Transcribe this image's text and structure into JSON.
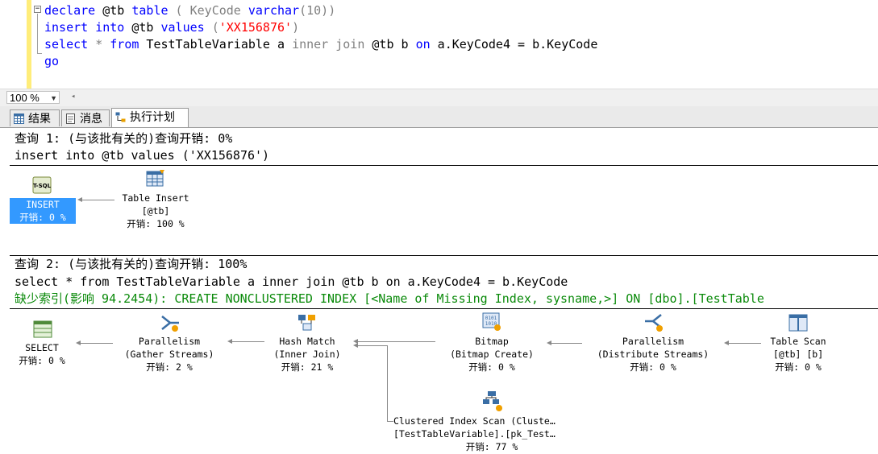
{
  "editor": {
    "line1": {
      "kw1": "declare",
      "var": " @tb ",
      "kw2": "table",
      "p1": " ( KeyCode ",
      "kw3": "varchar",
      "p2": "(10)",
      "p3": ")"
    },
    "line2": {
      "kw1": "insert",
      "sp1": " ",
      "kw2": "into",
      "var": " @tb ",
      "kw3": "values",
      "p1": " (",
      "str": "'XX156876'",
      "p2": ")"
    },
    "line3": {
      "kw1": "select",
      "op": " * ",
      "kw2": "from",
      "t1": " TestTableVariable a ",
      "kw3": "inner join",
      "t2": " @tb b ",
      "kw4": "on",
      "t3": " a.KeyCode4 = b.KeyCode"
    },
    "line4": {
      "kw1": "go"
    }
  },
  "zoom": {
    "value": "100 %"
  },
  "tabs": [
    {
      "label": "结果",
      "icon": "grid-icon"
    },
    {
      "label": "消息",
      "icon": "message-icon"
    },
    {
      "label": "执行计划",
      "icon": "execution-plan-icon"
    }
  ],
  "query1": {
    "header": "查询 1: (与该批有关的)查询开销: 0%",
    "sql": "insert into @tb values ('XX156876')",
    "nodes": {
      "insert": {
        "l1": "INSERT",
        "cost": "开销: 0 %"
      },
      "table_insert": {
        "l1": "Table Insert",
        "l2": "[@tb]",
        "cost": "开销: 100 %"
      }
    }
  },
  "query2": {
    "header": "查询 2: (与该批有关的)查询开销: 100%",
    "sql": "select * from TestTableVariable a inner join @tb b on a.KeyCode4 = b.KeyCode",
    "missing_index": "缺少索引(影响 94.2454): CREATE NONCLUSTERED INDEX [<Name of Missing Index, sysname,>] ON [dbo].[TestTable",
    "nodes": {
      "select": {
        "l1": "SELECT",
        "cost": "开销: 0 %"
      },
      "gather": {
        "l1": "Parallelism",
        "l2": "(Gather Streams)",
        "cost": "开销: 2 %"
      },
      "hash": {
        "l1": "Hash Match",
        "l2": "(Inner Join)",
        "cost": "开销: 21 %"
      },
      "bitmap": {
        "l1": "Bitmap",
        "l2": "(Bitmap Create)",
        "cost": "开销: 0 %"
      },
      "distribute": {
        "l1": "Parallelism",
        "l2": "(Distribute Streams)",
        "cost": "开销: 0 %"
      },
      "table_scan": {
        "l1": "Table Scan",
        "l2": "[@tb] [b]",
        "cost": "开销: 0 %"
      },
      "clustered_scan": {
        "l1": "Clustered Index Scan (Cluste…",
        "l2": "[TestTableVariable].[pk_Test…",
        "cost": "开销: 77 %"
      }
    }
  },
  "colors": {
    "keyword": "#0000ff",
    "function": "#ff00ff",
    "string": "#ff0000",
    "missing_index": "#0a8a0a",
    "selection": "#3399ff"
  }
}
